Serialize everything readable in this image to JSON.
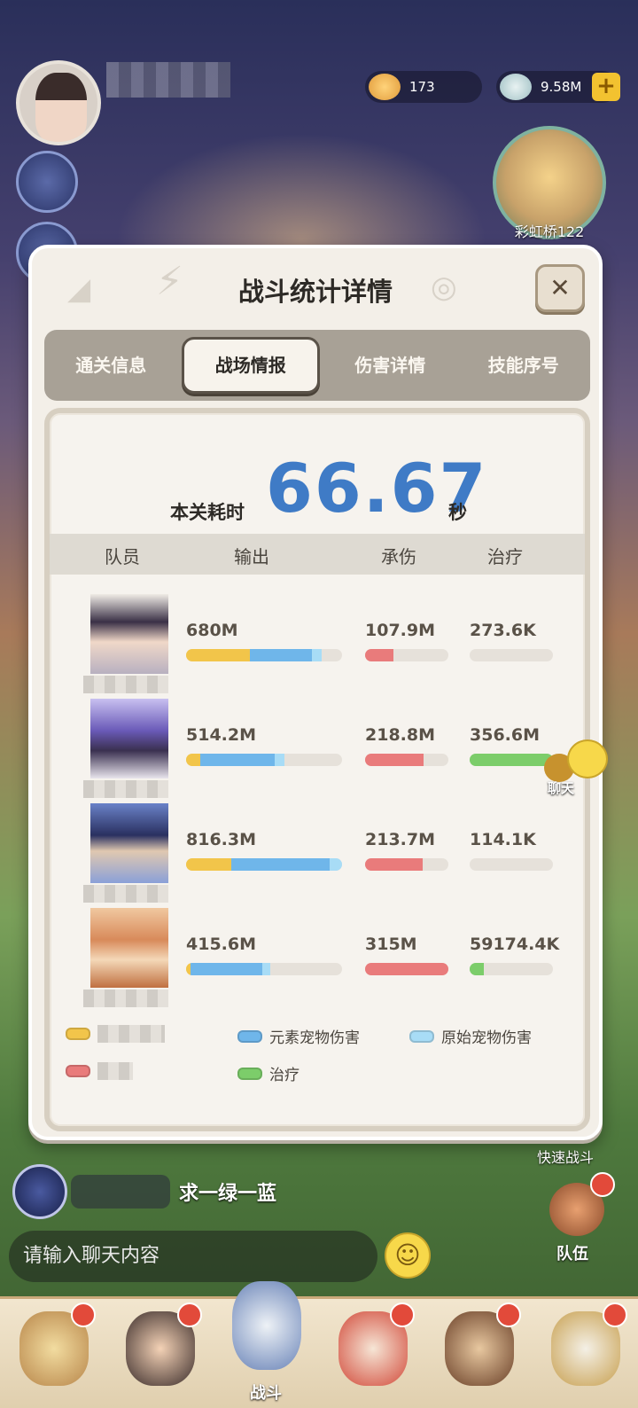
{
  "resources": {
    "shells": "173",
    "stones": "9.58M",
    "add_label": "+"
  },
  "map_node": {
    "label": "彩虹桥122"
  },
  "modal": {
    "title": "战斗统计详情",
    "close_label": "✕",
    "tabs": [
      {
        "label": "通关信息",
        "active": false
      },
      {
        "label": "战场情报",
        "active": true
      },
      {
        "label": "伤害详情",
        "active": false
      },
      {
        "label": "技能序号",
        "active": false
      }
    ],
    "time": {
      "label": "本关耗时",
      "value": "66.67",
      "unit": "秒"
    },
    "columns": {
      "member": "队员",
      "output": "输出",
      "taken": "承伤",
      "heal": "治疗"
    },
    "rows": [
      {
        "output": "680M",
        "output_bar": {
          "yellow": 0.41,
          "blue": 0.4,
          "light": 0.06
        },
        "taken": "107.9M",
        "taken_bar": 0.34,
        "heal": "273.6K",
        "heal_bar": 0.0
      },
      {
        "output": "514.2M",
        "output_bar": {
          "yellow": 0.09,
          "blue": 0.48,
          "light": 0.06
        },
        "taken": "218.8M",
        "taken_bar": 0.7,
        "heal": "356.6M",
        "heal_bar": 1.0
      },
      {
        "output": "816.3M",
        "output_bar": {
          "yellow": 0.29,
          "blue": 0.63,
          "light": 0.08
        },
        "taken": "213.7M",
        "taken_bar": 0.69,
        "heal": "114.1K",
        "heal_bar": 0.0
      },
      {
        "output": "415.6M",
        "output_bar": {
          "yellow": 0.03,
          "blue": 0.46,
          "light": 0.05
        },
        "taken": "315M",
        "taken_bar": 1.0,
        "heal": "59174.4K",
        "heal_bar": 0.17
      }
    ],
    "legend": {
      "element_pet": "元素宠物伤害",
      "original_pet": "原始宠物伤害",
      "heal": "治疗"
    }
  },
  "colors": {
    "yellow": "#f2c54a",
    "blue": "#6fb6ea",
    "light_blue": "#a8dcf6",
    "red": "#e97b7b",
    "green": "#7ccd6a",
    "time_blue": "#3f7bc6"
  },
  "chat_float": {
    "label": "聊天"
  },
  "quick_battle": "快速战斗",
  "chat": {
    "message": "求一绿一蓝",
    "input_placeholder": "请输入聊天内容"
  },
  "team": {
    "label": "队伍"
  },
  "nav": {
    "battle_label": "战斗"
  }
}
